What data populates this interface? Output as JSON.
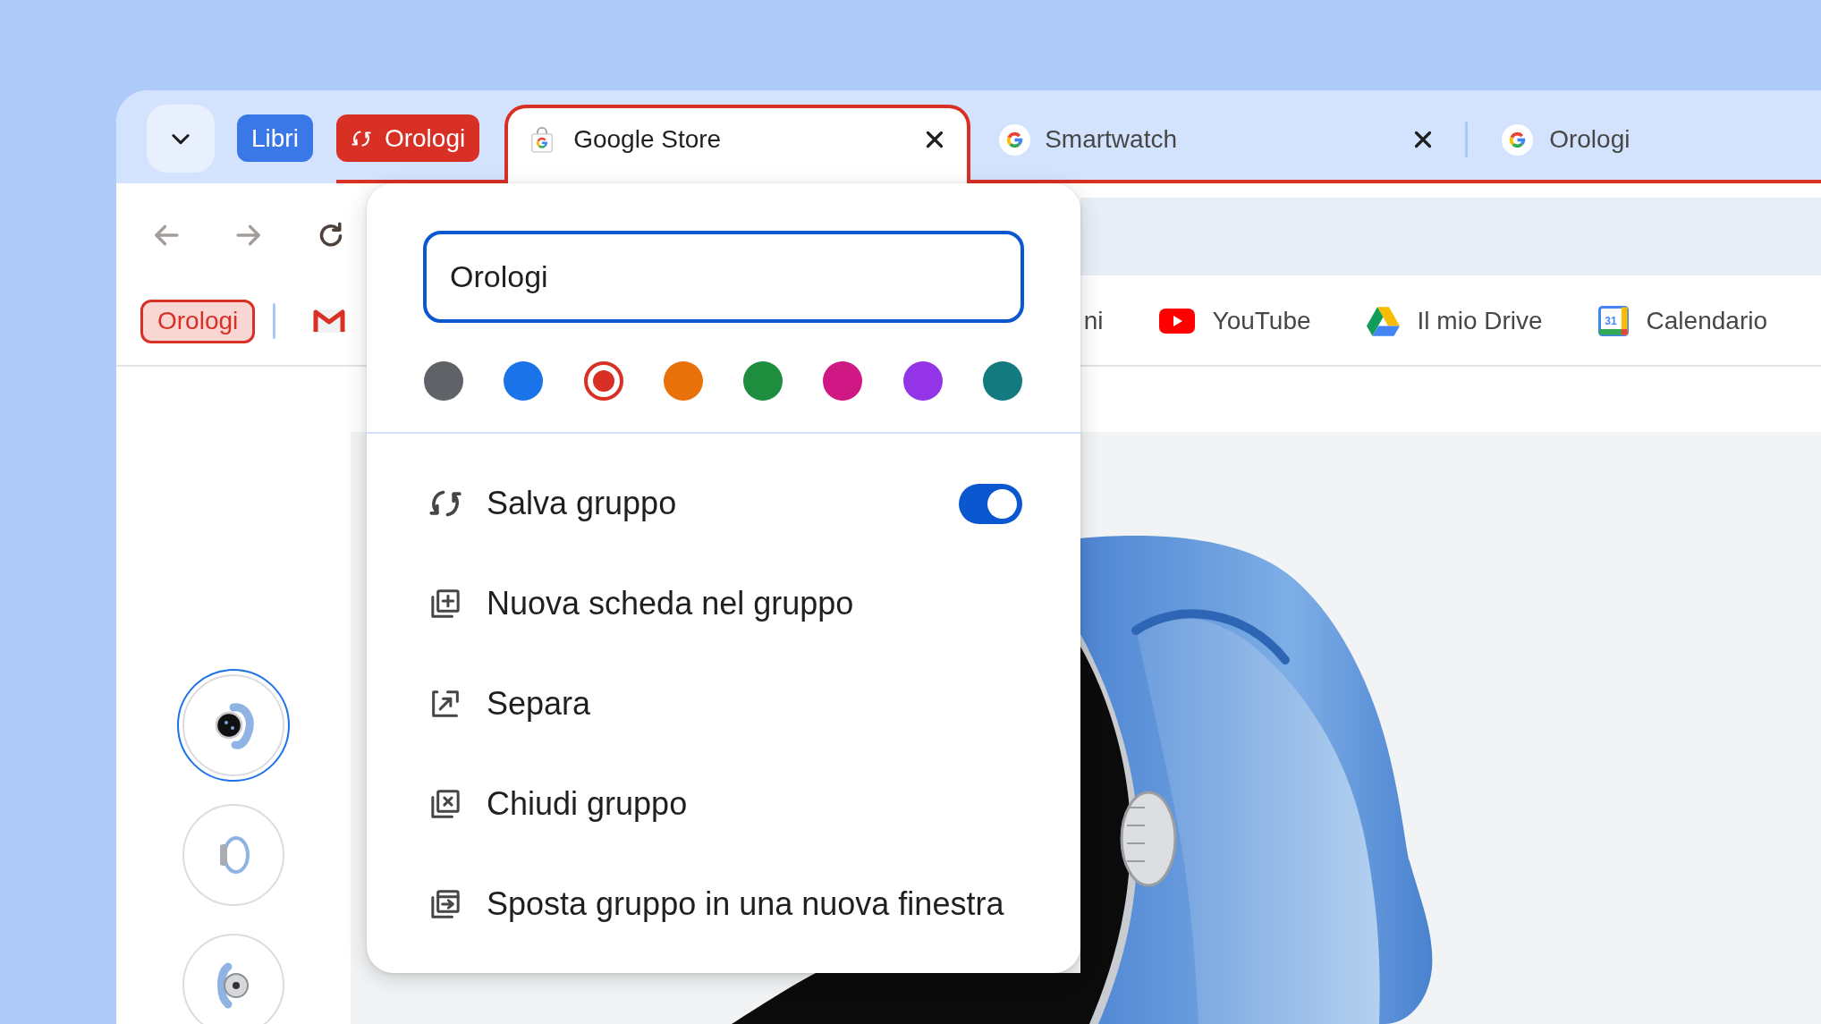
{
  "tab_strip": {
    "groups": [
      {
        "label": "Libri",
        "color": "#3b78e7",
        "saved": false
      },
      {
        "label": "Orologi",
        "color": "#d93025",
        "saved": true,
        "tabs": [
          {
            "kind": "store",
            "title": "Google Store",
            "selected": true,
            "close_button": true
          },
          {
            "kind": "google",
            "title": "Smartwatch",
            "selected": false,
            "close_button": true
          },
          {
            "kind": "google",
            "title": "Orologi",
            "selected": false,
            "close_button": false
          }
        ]
      }
    ]
  },
  "toolbar": {
    "buttons": [
      {
        "kind": "back",
        "disabled": true
      },
      {
        "kind": "forward",
        "disabled": true
      },
      {
        "kind": "reload",
        "disabled": false
      }
    ]
  },
  "bookmarks_bar": {
    "items": [
      {
        "kind": "group",
        "label": "Orologi",
        "color": "#d93025"
      },
      {
        "kind": "mail"
      },
      {
        "kind": "text",
        "label": "ni"
      },
      {
        "kind": "video",
        "label": "YouTube"
      },
      {
        "kind": "drive",
        "label": "Il mio Drive"
      },
      {
        "kind": "calendar",
        "label": "Calendario",
        "icon_text": "31"
      }
    ]
  },
  "group_editor": {
    "name_field": {
      "value": "Orologi"
    },
    "colors": [
      {
        "color": "#5f6368",
        "selected": false
      },
      {
        "color": "#1a73e8",
        "selected": false
      },
      {
        "color": "#d93025",
        "selected": true
      },
      {
        "color": "#e8710a",
        "selected": false
      },
      {
        "color": "#1e8e3e",
        "selected": false
      },
      {
        "color": "#d01884",
        "selected": false
      },
      {
        "color": "#9334e6",
        "selected": false
      },
      {
        "color": "#137b80",
        "selected": false
      }
    ],
    "menu": [
      {
        "kind": "save",
        "label": "Salva gruppo",
        "on": true
      },
      {
        "kind": "new_tab",
        "label": "Nuova scheda nel gruppo"
      },
      {
        "kind": "ungroup",
        "label": "Separa"
      },
      {
        "kind": "close",
        "label": "Chiudi gruppo"
      },
      {
        "kind": "move",
        "label": "Sposta gruppo in una nuova finestra"
      }
    ]
  },
  "gallery": {
    "thumbnails": [
      {
        "kind": "front",
        "selected": true
      },
      {
        "kind": "side",
        "selected": false
      },
      {
        "kind": "back",
        "selected": false
      }
    ]
  }
}
